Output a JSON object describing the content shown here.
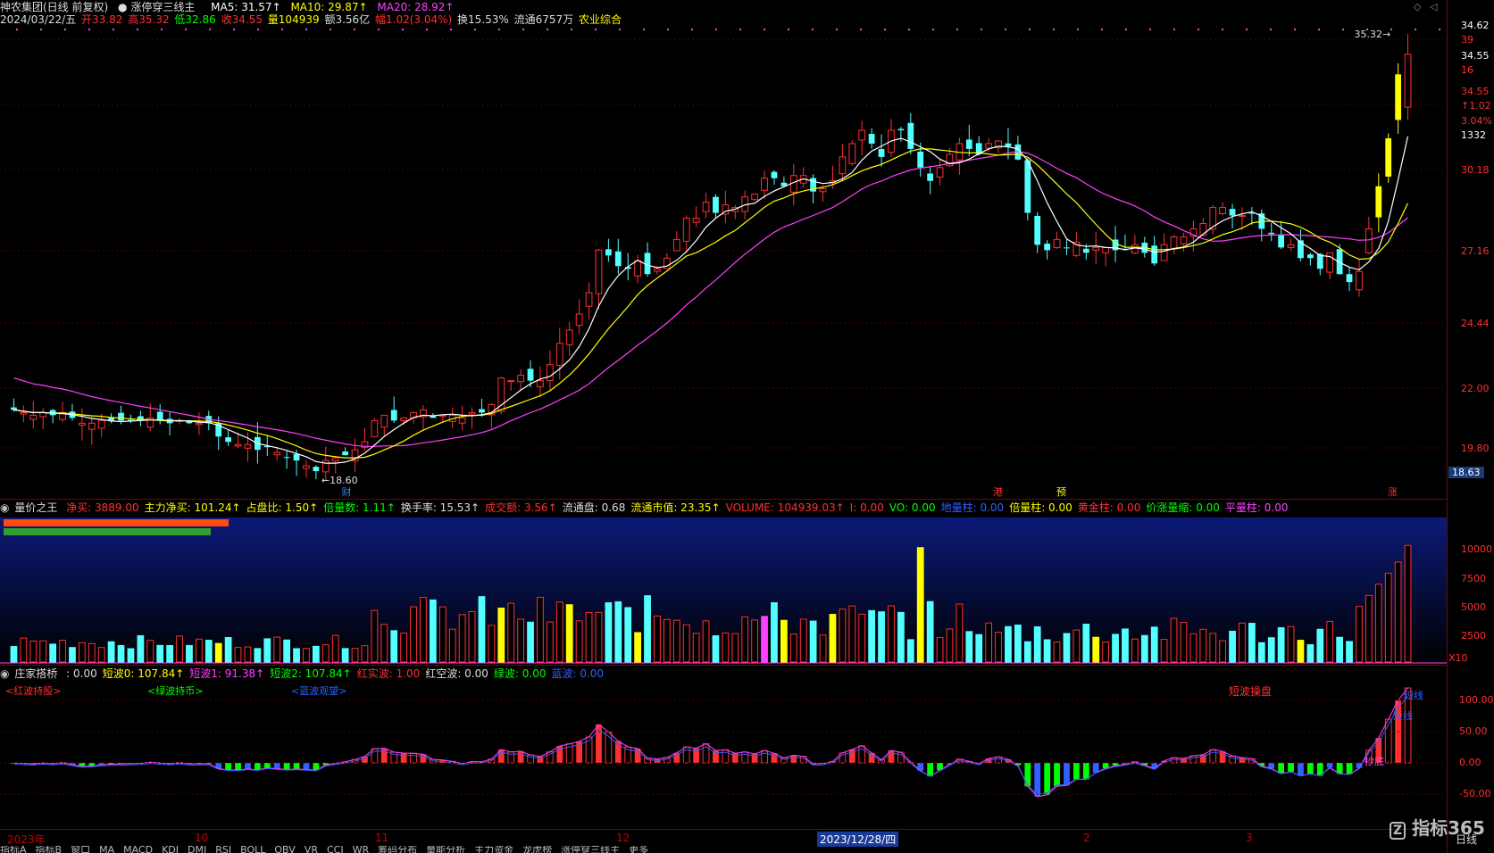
{
  "header": {
    "stock_name": "神农集团(日线 前复权)",
    "indicator_name": "涨停穿三线主",
    "ma5": "MA5: 31.57↑",
    "ma10": "MA10: 29.87↑",
    "ma20": "MA20: 28.92↑",
    "ohlc": {
      "date": "2024/03/22/五",
      "open": "开33.82",
      "high": "高35.32",
      "low": "低32.86",
      "close": "收34.55",
      "volume": "量104939",
      "amount": "额3.56亿",
      "change": "幅1.02(3.04%)",
      "turnover": "换15.53%",
      "float": "流通6757万",
      "sector": "农业综合"
    }
  },
  "main_chart": {
    "price_axis": [
      "34.62",
      "39",
      "34.55",
      "16",
      "34.55",
      "↑1.02",
      "3.04%",
      "1332",
      "30.18",
      "27.16",
      "24.44",
      "22.00",
      "19.80",
      "18.63"
    ],
    "annotations": {
      "low_label": "18.60",
      "high_label": "35.32",
      "event_cai": "财",
      "event_gang": "港",
      "event_yu": "预",
      "event_zhang": "涨"
    }
  },
  "volume_pane": {
    "title": "量价之王",
    "fields": [
      {
        "label": "净买: 3889.00",
        "color": "#ff3030"
      },
      {
        "label": "主力净买: 101.24↑",
        "color": "#ffff00"
      },
      {
        "label": "占盘比: 1.50↑",
        "color": "#ffff00"
      },
      {
        "label": "倍量数: 1.11↑",
        "color": "#00ff00"
      },
      {
        "label": "换手率: 15.53↑",
        "color": "#dddddd"
      },
      {
        "label": "成交额: 3.56↑",
        "color": "#ff3030"
      },
      {
        "label": "流通盘: 0.68",
        "color": "#dddddd"
      },
      {
        "label": "流通市值: 23.35↑",
        "color": "#ffff00"
      },
      {
        "label": "VOLUME: 104939.03↑",
        "color": "#ff3030"
      },
      {
        "label": "I: 0.00",
        "color": "#ff3030"
      },
      {
        "label": "VO: 0.00",
        "color": "#00ff00"
      },
      {
        "label": "地量柱: 0.00",
        "color": "#3060ff"
      },
      {
        "label": "倍量柱: 0.00",
        "color": "#ffff00"
      },
      {
        "label": "黄金柱: 0.00",
        "color": "#ff3030"
      },
      {
        "label": "价涨量缩: 0.00",
        "color": "#00ff00"
      },
      {
        "label": "平量柱: 0.00",
        "color": "#ff40ff"
      }
    ],
    "axis": [
      "10000",
      "7500",
      "5000",
      "2500",
      "X10"
    ]
  },
  "zhuang_pane": {
    "title": "庄家搭桥",
    "fields": [
      {
        "label": ": 0.00",
        "color": "#dddddd"
      },
      {
        "label": "短波0: 107.84↑",
        "color": "#ffff00"
      },
      {
        "label": "短波1: 91.38↑",
        "color": "#ff40ff"
      },
      {
        "label": "短波2: 107.84↑",
        "color": "#00ff00"
      },
      {
        "label": "红实波: 1.00",
        "color": "#ff3030"
      },
      {
        "label": "红空波: 0.00",
        "color": "#dddddd"
      },
      {
        "label": "绿波: 0.00",
        "color": "#00ff00"
      },
      {
        "label": "蓝波: 0.00",
        "color": "#3060ff"
      }
    ],
    "tags": {
      "red_hold": "<红波持股>",
      "green_hold": "<绿波持币>",
      "blue_wait": "<蓝波观望>",
      "short_op": "短波操盘",
      "short_op2": "短线",
      "buy": "短线",
      "buy2": "抄底"
    },
    "axis": [
      "100.00",
      "50.00",
      "0.00",
      "-50.00"
    ]
  },
  "date_axis": [
    "2023年",
    "10",
    "11",
    "12",
    "2023/12/28/四",
    "2",
    "3"
  ],
  "footer": {
    "period": "日线",
    "brand": "指标365"
  },
  "tabs": [
    "指标A",
    "指标B",
    "窗口",
    "MA",
    "MACD",
    "KDJ",
    "DMI",
    "RSI",
    "BOLL",
    "OBV",
    "VR",
    "CCI",
    "WR",
    "筹码分布",
    "量能分析",
    "主力资金",
    "龙虎榜",
    "涨停穿三线主",
    "更多"
  ],
  "chart_data": [
    {
      "type": "candlestick",
      "title": "神农集团(日线 前复权)",
      "ylim": [
        18.6,
        35.32
      ],
      "series_names": [
        "MA5",
        "MA10",
        "MA20"
      ],
      "closes": [
        21.2,
        21.1,
        21.0,
        21.1,
        21.0,
        21.1,
        20.9,
        20.7,
        20.7,
        20.8,
        20.8,
        20.8,
        20.8,
        20.8,
        20.9,
        20.8,
        20.7,
        20.8,
        20.7,
        20.7,
        20.7,
        20.2,
        20.0,
        19.9,
        19.9,
        19.7,
        19.8,
        19.6,
        19.4,
        19.3,
        19.1,
        18.9,
        19.3,
        19.4,
        19.5,
        19.7,
        20.0,
        20.8,
        21.0,
        20.8,
        20.9,
        21.1,
        21.2,
        20.9,
        21.0,
        21.0,
        20.9,
        21.1,
        21.1,
        21.4,
        22.4,
        22.3,
        22.5,
        22.3,
        22.3,
        22.9,
        23.7,
        24.2,
        24.8,
        25.6,
        27.2,
        27.0,
        26.6,
        26.5,
        26.8,
        26.3,
        26.5,
        26.9,
        27.6,
        28.4,
        28.4,
        29.0,
        28.6,
        28.9,
        28.8,
        29.2,
        29.3,
        29.9,
        29.9,
        29.6,
        30.0,
        30.0,
        29.4,
        29.5,
        29.8,
        30.7,
        31.2,
        31.7,
        31.2,
        30.7,
        31.7,
        31.7,
        31.0,
        30.3,
        29.8,
        30.3,
        30.8,
        31.2,
        31.0,
        30.8,
        31.2,
        31.3,
        31.1,
        30.6,
        28.6,
        27.4,
        27.2,
        27.6,
        27.3,
        27.5,
        27.1,
        27.3,
        27.3,
        27.2,
        27.2,
        27.4,
        27.1,
        26.7,
        27.4,
        27.7,
        27.7,
        28.0,
        28.2,
        28.8,
        28.8,
        28.5,
        28.5,
        28.6,
        28.0,
        27.8,
        27.3,
        27.4,
        26.9,
        26.9,
        26.5,
        27.1,
        26.3,
        26.0,
        26.4,
        28.0,
        29.6,
        31.4,
        33.8,
        34.55
      ]
    },
    {
      "type": "bar",
      "title": "量价之王",
      "unit": "X10",
      "ylim": [
        0,
        11000
      ]
    },
    {
      "type": "bar",
      "title": "庄家搭桥",
      "ylim": [
        -80,
        130
      ]
    }
  ]
}
